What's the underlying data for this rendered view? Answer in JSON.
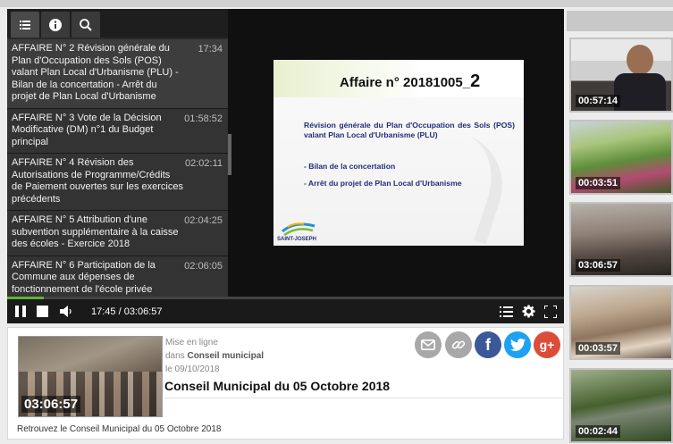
{
  "player": {
    "chapters": [
      {
        "label": "AFFAIRE N° 2 Révision générale du Plan d'Occupation des Sols (POS) valant Plan Local d'Urbanisme (PLU) - Bilan de la concertation - Arrêt du projet de Plan Local d'Urbanisme",
        "time": "17:34"
      },
      {
        "label": "AFFAIRE N° 3 Vote de la Décision Modificative (DM) n°1 du Budget principal",
        "time": "01:58:52"
      },
      {
        "label": "AFFAIRE N° 4 Révision des Autorisations de Programme/Crédits de Paiement ouvertes sur les exercices précédents",
        "time": "02:02:11"
      },
      {
        "label": "AFFAIRE N° 5 Attribution d'une subvention supplémentaire à la caisse des écoles - Exercice 2018",
        "time": "02:04:25"
      },
      {
        "label": "AFFAIRE N° 6 Participation de la Commune aux dépenses de fonctionnement de l'école privée",
        "time": "02:06:05"
      }
    ],
    "slide": {
      "title_prefix": "Affaire n° 20181005_",
      "title_suffix": "2",
      "body": "Révision générale du Plan d'Occupation des Sols (POS) valant Plan Local d'Urbanisme (PLU)",
      "bullet1": "- Bilan de la concertation",
      "bullet2": "- Arrêt du projet de Plan Local d'Urbanisme",
      "logo_text": "SAINT-JOSEPH"
    },
    "progress_fraction": 0.066,
    "time_display": "17:45 / 03:06:57",
    "accent_color": "#5fb236"
  },
  "video": {
    "duration": "03:06:57",
    "meta_line1": "Mise en ligne",
    "meta_line2_prefix": "dans",
    "meta_line2_category": "Conseil municipal",
    "meta_line3": "le 09/10/2018",
    "title": "Conseil Municipal du 05 Octobre 2018",
    "description": "Retrouvez le Conseil Municipal du 05 Octobre 2018"
  },
  "share": [
    {
      "name": "email-icon",
      "color": "#a8a8a8",
      "glyph": "✉"
    },
    {
      "name": "link-icon",
      "color": "#a8a8a8",
      "glyph": "🔗"
    },
    {
      "name": "facebook-icon",
      "color": "#3b5998",
      "glyph": "f"
    },
    {
      "name": "twitter-icon",
      "color": "#1da1f2",
      "glyph": "t"
    },
    {
      "name": "googleplus-icon",
      "color": "#dd4b39",
      "glyph": "g+"
    }
  ],
  "sidebar": {
    "videos": [
      {
        "duration": "00:57:14"
      },
      {
        "duration": "00:03:51"
      },
      {
        "duration": "03:06:57"
      },
      {
        "duration": "00:03:57"
      },
      {
        "duration": "00:02:44"
      }
    ]
  }
}
